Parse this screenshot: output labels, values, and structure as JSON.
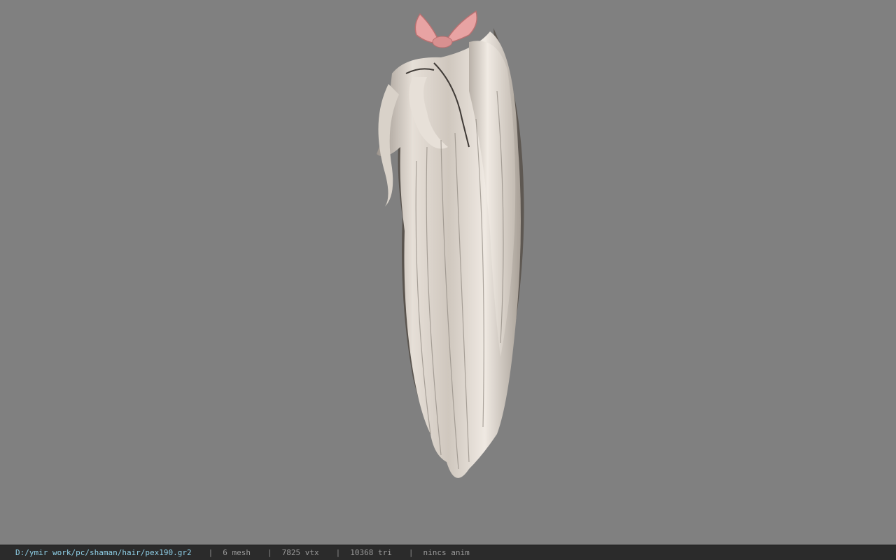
{
  "viewer": {
    "background_color": "#808080",
    "model_icon": "hair-model-render",
    "ribbon_color": "#e8a3a3",
    "hair_color": "#ddd5cc"
  },
  "status_bar": {
    "file_path": "D:/ymir work/pc/shaman/hair/pex190.gr2",
    "separator": "|",
    "mesh_count": "6 mesh",
    "vertex_count": "7825 vtx",
    "triangle_count": "10368 tri",
    "animation": "nincs anim"
  }
}
